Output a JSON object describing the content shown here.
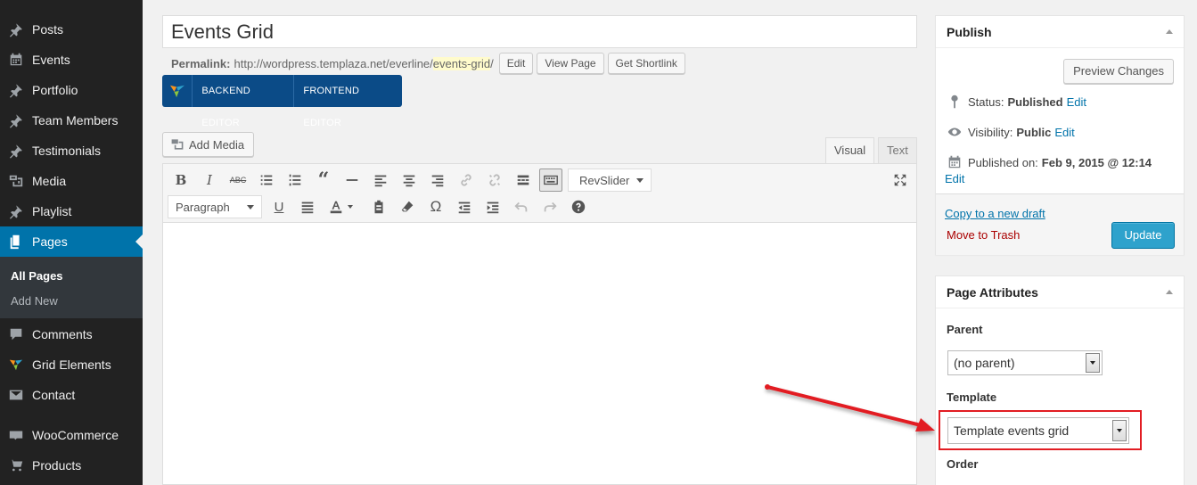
{
  "sidebar": {
    "items": [
      {
        "label": "Posts",
        "icon": "pin-icon"
      },
      {
        "label": "Events",
        "icon": "calendar-icon"
      },
      {
        "label": "Portfolio",
        "icon": "pin-icon"
      },
      {
        "label": "Team Members",
        "icon": "pin-icon"
      },
      {
        "label": "Testimonials",
        "icon": "pin-icon"
      },
      {
        "label": "Media",
        "icon": "media-icon"
      },
      {
        "label": "Playlist",
        "icon": "pin-icon"
      },
      {
        "label": "Pages",
        "icon": "pages-icon"
      },
      {
        "label": "Comments",
        "icon": "comment-icon"
      },
      {
        "label": "Grid Elements",
        "icon": "grid-elements-icon"
      },
      {
        "label": "Contact",
        "icon": "mail-icon"
      },
      {
        "label": "WooCommerce",
        "icon": "woo-icon"
      },
      {
        "label": "Products",
        "icon": "products-icon"
      }
    ],
    "submenu": [
      "All Pages",
      "Add New"
    ]
  },
  "editor": {
    "title": "Events Grid",
    "permalink_label": "Permalink:",
    "permalink_base": "http://wordpress.templaza.net/everline/",
    "permalink_slug": "events-grid",
    "permalink_trail": "/",
    "edit_btn": "Edit",
    "view_page_btn": "View Page",
    "shortlink_btn": "Get Shortlink",
    "backend_editor": "BACKEND EDITOR",
    "frontend_editor": "FRONTEND EDITOR",
    "add_media": "Add Media",
    "tab_visual": "Visual",
    "tab_text": "Text",
    "revslider": "RevSlider",
    "format_select": "Paragraph"
  },
  "publish": {
    "heading": "Publish",
    "preview_btn": "Preview Changes",
    "status_label": "Status:",
    "status_value": "Published",
    "visibility_label": "Visibility:",
    "visibility_value": "Public",
    "published_on_label": "Published on:",
    "published_on_value": "Feb 9, 2015 @ 12:14",
    "edit_link": "Edit",
    "copy_draft": "Copy to a new draft",
    "move_trash": "Move to Trash",
    "update_btn": "Update"
  },
  "attributes": {
    "heading": "Page Attributes",
    "parent_label": "Parent",
    "parent_value": "(no parent)",
    "template_label": "Template",
    "template_value": "Template events grid",
    "order_label": "Order"
  },
  "colors": {
    "sidebar_bg": "#222222",
    "active_blue": "#0073aa",
    "vc_blue": "#0b4b87",
    "update_blue": "#2ea2cc",
    "annotation_red": "#e21d23"
  }
}
